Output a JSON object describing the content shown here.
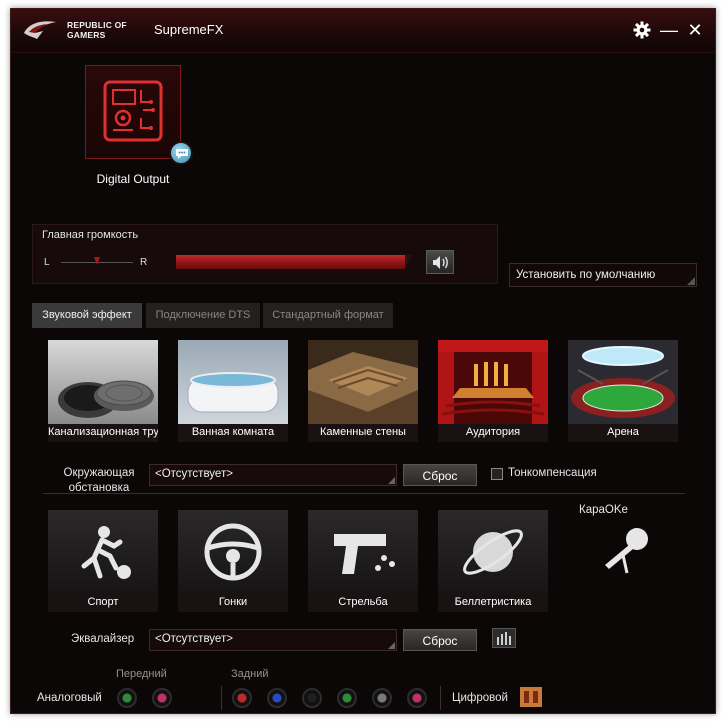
{
  "window": {
    "brand_line1": "REPUBLIC OF",
    "brand_line2": "GAMERS",
    "title": "SupremeFX",
    "settings_icon": "gear-icon",
    "minimize_glyph": "—",
    "close_glyph": "✕"
  },
  "device": {
    "label": "Digital Output",
    "icon": "circuit-board-icon",
    "badge_icon": "chat-bubble-icon"
  },
  "volume": {
    "title": "Главная громкость",
    "left_label": "L",
    "right_label": "R",
    "balance": 0.5,
    "level_percent": 97,
    "mute_icon": "speaker-icon"
  },
  "default_button_label": "Установить по умолчанию",
  "tabs": [
    {
      "label": "Звуковой эффект",
      "active": true
    },
    {
      "label": "Подключение DTS",
      "active": false
    },
    {
      "label": "Стандартный формат",
      "active": false
    }
  ],
  "environments": [
    {
      "label": "Канализационная труба"
    },
    {
      "label": "Ванная комната"
    },
    {
      "label": "Каменные стены"
    },
    {
      "label": "Аудитория"
    },
    {
      "label": "Арена"
    }
  ],
  "environment_row": {
    "label": "Окружающая обстановка",
    "select_value": "<Отсутствует>",
    "reset_label": "Сброс",
    "checkbox_label": "Тонкомпенсация",
    "checkbox_checked": false
  },
  "presets": [
    {
      "label": "Спорт",
      "icon": "runner-icon"
    },
    {
      "label": "Гонки",
      "icon": "steering-wheel-icon"
    },
    {
      "label": "Стрельба",
      "icon": "pistol-icon"
    },
    {
      "label": "Беллетристика",
      "icon": "planet-icon"
    }
  ],
  "karaoke_label": "КараOKe",
  "equalizer": {
    "label": "Эквалайзер",
    "select_value": "<Отсутствует>",
    "reset_label": "Сброс"
  },
  "jacks": {
    "front_label": "Передний",
    "rear_label": "Задний",
    "analog_label": "Аналоговый",
    "digital_label": "Цифровой",
    "front_colors": [
      "#2f8a3a",
      "#c0306a"
    ],
    "rear_colors": [
      "#c02a2a",
      "#2a4ac0",
      "#202020",
      "#2f8a3a",
      "#7a7a7a",
      "#c0306a"
    ]
  }
}
